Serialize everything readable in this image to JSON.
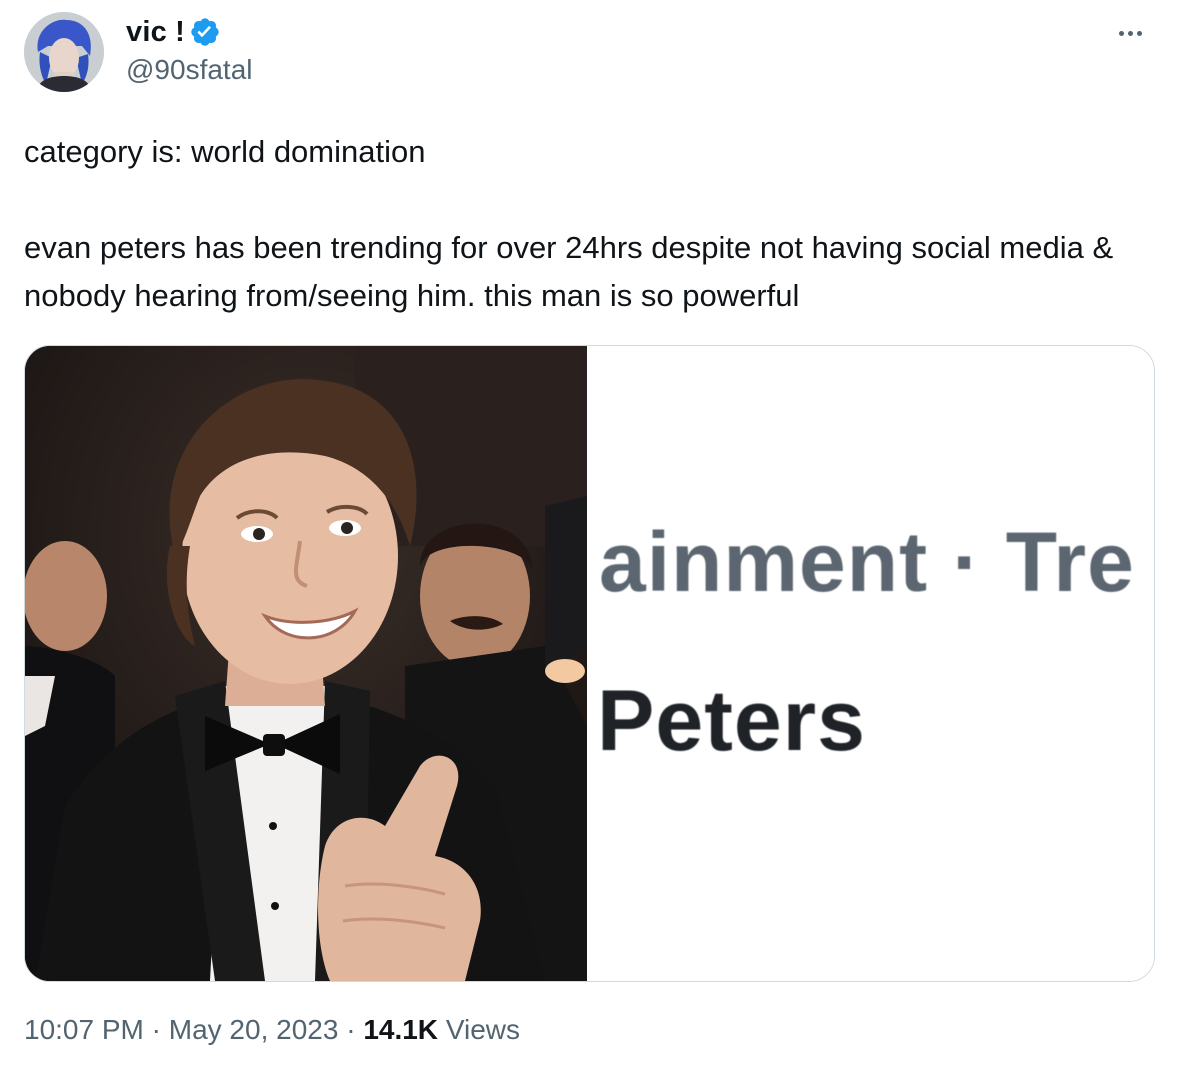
{
  "author": {
    "display_name": "vic !",
    "handle": "@90sfatal",
    "verified": true,
    "verified_color": "#1d9bf0"
  },
  "icons": {
    "verified": "verified-badge-icon",
    "more": "more-options-icon"
  },
  "tweet": {
    "line1": "category is: world domination",
    "line2": "evan peters has been trending for over 24hrs despite not having social media & nobody hearing from/seeing him. this man is so powerful"
  },
  "media": {
    "right_panel": {
      "category_text": "ainment · Tre",
      "name_text": "Peters"
    }
  },
  "meta": {
    "time": "10:07 PM",
    "separator": " · ",
    "date": "May 20, 2023",
    "views_count": "14.1K",
    "views_label": "Views"
  }
}
